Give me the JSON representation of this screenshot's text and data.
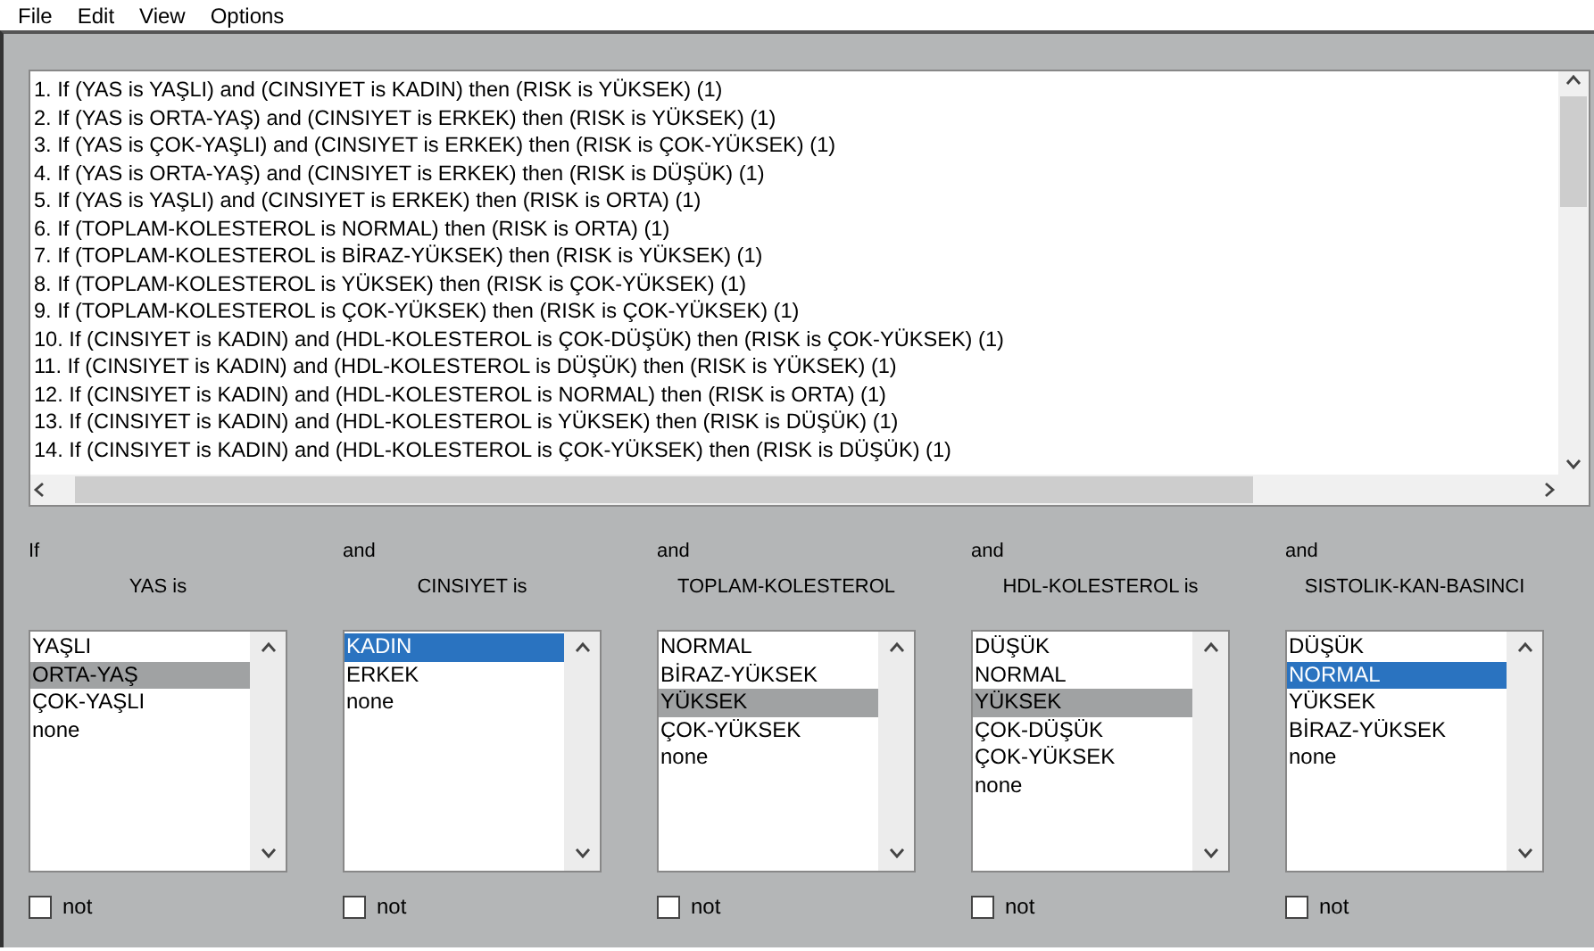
{
  "menu": [
    "File",
    "Edit",
    "View",
    "Options"
  ],
  "rules": [
    "1. If (YAS is YAŞLI) and (CINSIYET is KADIN) then (RISK is YÜKSEK) (1)",
    "2. If (YAS is ORTA-YAŞ) and (CINSIYET is ERKEK) then (RISK is YÜKSEK) (1)",
    "3. If (YAS is ÇOK-YAŞLI) and (CINSIYET is ERKEK) then (RISK is ÇOK-YÜKSEK) (1)",
    "4. If (YAS is ORTA-YAŞ) and (CINSIYET is ERKEK) then (RISK is DÜŞÜK) (1)",
    "5. If (YAS is YAŞLI) and (CINSIYET is ERKEK) then (RISK is ORTA) (1)",
    "6. If (TOPLAM-KOLESTEROL is NORMAL) then (RISK is ORTA) (1)",
    "7. If (TOPLAM-KOLESTEROL is BİRAZ-YÜKSEK) then (RISK is YÜKSEK) (1)",
    "8. If (TOPLAM-KOLESTEROL is YÜKSEK) then (RISK is ÇOK-YÜKSEK) (1)",
    "9. If (TOPLAM-KOLESTEROL is ÇOK-YÜKSEK) then (RISK is ÇOK-YÜKSEK) (1)",
    "10. If (CINSIYET is KADIN) and (HDL-KOLESTEROL is ÇOK-DÜŞÜK) then (RISK is ÇOK-YÜKSEK) (1)",
    "11. If (CINSIYET is KADIN) and (HDL-KOLESTEROL is DÜŞÜK) then (RISK is YÜKSEK) (1)",
    "12. If (CINSIYET is KADIN) and (HDL-KOLESTEROL is NORMAL) then (RISK is ORTA) (1)",
    "13. If (CINSIYET is KADIN) and (HDL-KOLESTEROL is YÜKSEK) then (RISK is DÜŞÜK) (1)",
    "14. If (CINSIYET is KADIN) and (HDL-KOLESTEROL is ÇOK-YÜKSEK) then (RISK is DÜŞÜK) (1)"
  ],
  "inputs": [
    {
      "connective": "If",
      "heading": "YAS is",
      "active": false,
      "not_checked": false,
      "label": "not",
      "items": [
        {
          "text": "YAŞLI",
          "selected": false
        },
        {
          "text": "ORTA-YAŞ",
          "selected": true
        },
        {
          "text": "ÇOK-YAŞLI",
          "selected": false
        },
        {
          "text": "none",
          "selected": false
        }
      ]
    },
    {
      "connective": "and",
      "heading": "CINSIYET is",
      "active": true,
      "not_checked": false,
      "label": "not",
      "items": [
        {
          "text": "KADIN",
          "selected": true
        },
        {
          "text": "ERKEK",
          "selected": false
        },
        {
          "text": "none",
          "selected": false
        }
      ]
    },
    {
      "connective": "and",
      "heading": "TOPLAM-KOLESTEROL",
      "active": false,
      "not_checked": false,
      "label": "not",
      "items": [
        {
          "text": "NORMAL",
          "selected": false
        },
        {
          "text": "BİRAZ-YÜKSEK",
          "selected": false
        },
        {
          "text": "YÜKSEK",
          "selected": true
        },
        {
          "text": "ÇOK-YÜKSEK",
          "selected": false
        },
        {
          "text": "none",
          "selected": false
        }
      ]
    },
    {
      "connective": "and",
      "heading": "HDL-KOLESTEROL is",
      "active": false,
      "not_checked": false,
      "label": "not",
      "items": [
        {
          "text": "DÜŞÜK",
          "selected": false
        },
        {
          "text": "NORMAL",
          "selected": false
        },
        {
          "text": "YÜKSEK",
          "selected": true
        },
        {
          "text": "ÇOK-DÜŞÜK",
          "selected": false
        },
        {
          "text": "ÇOK-YÜKSEK",
          "selected": false
        },
        {
          "text": "none",
          "selected": false
        }
      ]
    },
    {
      "connective": "and",
      "heading": "SISTOLIK-KAN-BASINCI",
      "active": true,
      "not_checked": false,
      "label": "not",
      "items": [
        {
          "text": "DÜŞÜK",
          "selected": false
        },
        {
          "text": "NORMAL",
          "selected": true
        },
        {
          "text": "YÜKSEK",
          "selected": false
        },
        {
          "text": "BİRAZ-YÜKSEK",
          "selected": false
        },
        {
          "text": "none",
          "selected": false
        }
      ]
    }
  ]
}
